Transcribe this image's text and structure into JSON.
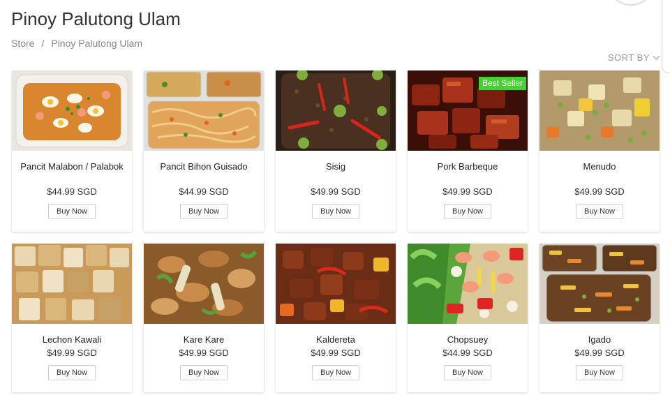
{
  "page": {
    "title": "Pinoy Palutong Ulam",
    "breadcrumb": {
      "home": "Store",
      "separator": "/",
      "current": "Pinoy Palutong Ulam"
    },
    "sort_label": "SORT BY"
  },
  "badge_color": "#45d12f",
  "products": [
    {
      "name": "Pancit Malabon / Palabok",
      "price": "$44.99 SGD",
      "button": "Buy Now",
      "image": "pancit-malabon"
    },
    {
      "name": "Pancit Bihon Guisado",
      "price": "$44.99 SGD",
      "button": "Buy Now",
      "image": "pancit-bihon"
    },
    {
      "name": "Sisig",
      "price": "$49.99 SGD",
      "button": "Buy Now",
      "image": "sisig"
    },
    {
      "name": "Pork Barbeque",
      "price": "$49.99 SGD",
      "button": "Buy Now",
      "badge": "Best Seller",
      "image": "pork-barbeque"
    },
    {
      "name": "Menudo",
      "price": "$49.99 SGD",
      "button": "Buy Now",
      "image": "menudo"
    },
    {
      "name": "Lechon Kawali",
      "price": "$49.99 SGD",
      "button": "Buy Now",
      "image": "lechon-kawali"
    },
    {
      "name": "Kare Kare",
      "price": "$49.99 SGD",
      "button": "Buy Now",
      "image": "kare-kare"
    },
    {
      "name": "Kaldereta",
      "price": "$49.99 SGD",
      "button": "Buy Now",
      "image": "kaldereta"
    },
    {
      "name": "Chopsuey",
      "price": "$44.99 SGD",
      "button": "Buy Now",
      "image": "chopsuey"
    },
    {
      "name": "Igado",
      "price": "$49.99 SGD",
      "button": "Buy Now",
      "image": "igado"
    }
  ]
}
